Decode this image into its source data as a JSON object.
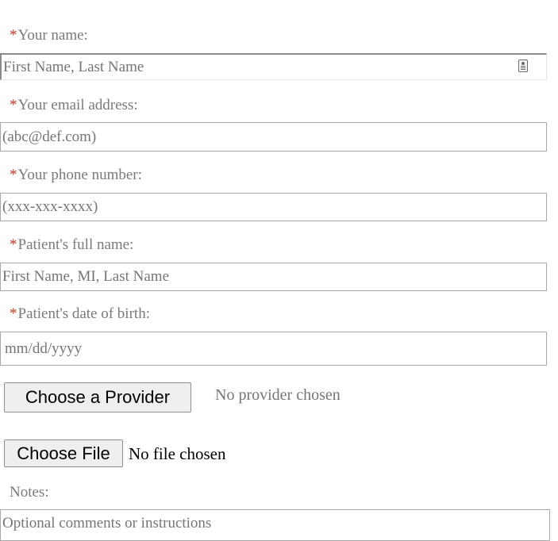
{
  "required_marker": "*",
  "fields": {
    "name": {
      "label": "Your name:",
      "placeholder": "First Name, Last Name"
    },
    "email": {
      "label": "Your email address:",
      "placeholder": "(abc@def.com)"
    },
    "phone": {
      "label": "Your phone number:",
      "placeholder": "(xxx-xxx-xxxx)"
    },
    "patient_name": {
      "label": "Patient's full name:",
      "placeholder": "First Name, MI, Last Name"
    },
    "patient_dob": {
      "label": "Patient's date of birth:",
      "placeholder": "mm/dd/yyyy"
    }
  },
  "provider": {
    "button_label": "Choose a Provider",
    "status": "No provider chosen"
  },
  "file": {
    "button_label": "Choose File",
    "status": "No file chosen"
  },
  "notes": {
    "label": "Notes:",
    "placeholder": "Optional comments or instructions"
  },
  "icons": {
    "autofill": "contact-card-icon"
  },
  "colors": {
    "required": "#c0392b",
    "label_text": "#7a7a7a",
    "placeholder_text": "#757575",
    "button_bg": "#efefef",
    "field_border": "#a9a9a9"
  }
}
